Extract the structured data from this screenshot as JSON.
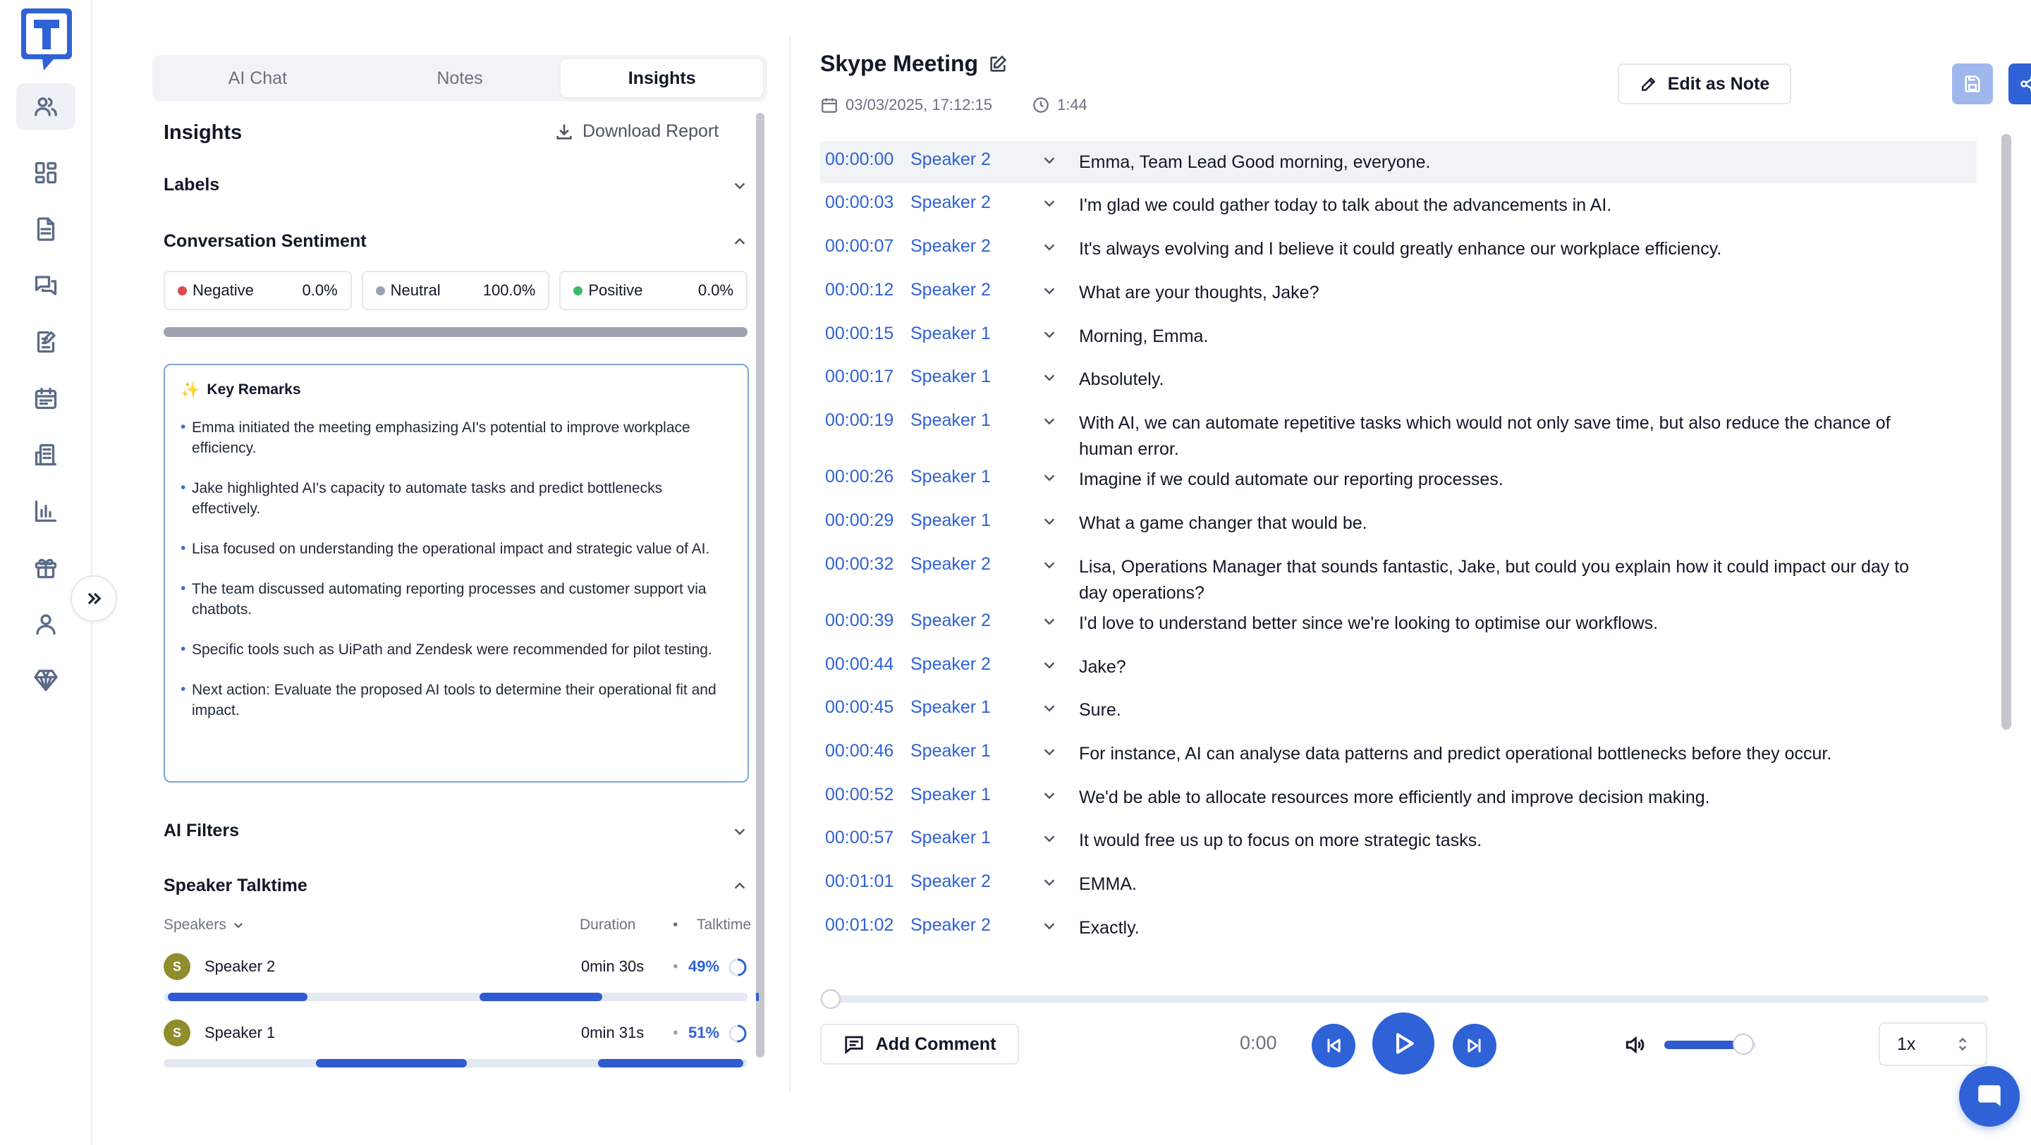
{
  "colors": {
    "accent": "#2f62d6",
    "negative": "#e0484e",
    "neutral": "#9ca3af",
    "positive": "#3fb86b",
    "avatar": "#8f8d2c"
  },
  "logo": {
    "letter": "T"
  },
  "nav": [
    {
      "icon": "users-icon",
      "active": true
    },
    {
      "icon": "dashboard-icon"
    },
    {
      "icon": "document-icon"
    },
    {
      "icon": "chat-icon"
    },
    {
      "icon": "edit-note-icon"
    },
    {
      "icon": "calendar-icon"
    },
    {
      "icon": "building-icon"
    },
    {
      "icon": "bar-chart-icon"
    },
    {
      "icon": "gift-icon"
    },
    {
      "icon": "user-icon"
    },
    {
      "icon": "diamond-icon"
    }
  ],
  "panel": {
    "tabs": [
      "AI Chat",
      "Notes",
      "Insights"
    ],
    "active_tab": "Insights",
    "title": "Insights",
    "download_label": "Download Report",
    "labels_heading": "Labels",
    "sentiment_heading": "Conversation Sentiment",
    "sentiment": [
      {
        "label": "Negative",
        "value": "0.0%"
      },
      {
        "label": "Neutral",
        "value": "100.0%"
      },
      {
        "label": "Positive",
        "value": "0.0%"
      }
    ],
    "key_remarks_title": "Key Remarks",
    "key_remarks": [
      "Emma initiated the meeting emphasizing AI's potential to improve workplace efficiency.",
      "Jake highlighted AI's capacity to automate tasks and predict bottlenecks effectively.",
      "Lisa focused on understanding the operational impact and strategic value of AI.",
      "The team discussed automating reporting processes and customer support via chatbots.",
      "Specific tools such as UiPath and Zendesk were recommended for pilot testing.",
      "Next action: Evaluate the proposed AI tools to determine their operational fit and impact."
    ],
    "ai_filters_heading": "AI Filters",
    "talktime_heading": "Speaker Talktime",
    "talktime_cols": {
      "speakers": "Speakers",
      "duration": "Duration",
      "sep": "•",
      "talktime": "Talktime"
    },
    "speakers": [
      {
        "initial": "S",
        "name": "Speaker 2",
        "duration": "0min 30s",
        "sep": "•",
        "pct": "49%",
        "fraction": 0.49
      },
      {
        "initial": "S",
        "name": "Speaker 1",
        "duration": "0min 31s",
        "sep": "•",
        "pct": "51%",
        "fraction": 0.51
      }
    ]
  },
  "meeting": {
    "title": "Skype Meeting",
    "datetime": "03/03/2025, 17:12:15",
    "duration": "1:44",
    "edit_note_label": "Edit as Note"
  },
  "transcript": [
    {
      "time": "00:00:00",
      "speaker": "Speaker 2",
      "text": "Emma, Team Lead Good morning, everyone."
    },
    {
      "time": "00:00:03",
      "speaker": "Speaker 2",
      "text": "I'm glad we could gather today to talk about the advancements in AI."
    },
    {
      "time": "00:00:07",
      "speaker": "Speaker 2",
      "text": "It's always evolving and I believe it could greatly enhance our workplace efficiency."
    },
    {
      "time": "00:00:12",
      "speaker": "Speaker 2",
      "text": "What are your thoughts, Jake?"
    },
    {
      "time": "00:00:15",
      "speaker": "Speaker 1",
      "text": "Morning, Emma."
    },
    {
      "time": "00:00:17",
      "speaker": "Speaker 1",
      "text": "Absolutely."
    },
    {
      "time": "00:00:19",
      "speaker": "Speaker 1",
      "text": "With AI, we can automate repetitive tasks which would not only save time, but also reduce the chance of human error."
    },
    {
      "time": "00:00:26",
      "speaker": "Speaker 1",
      "text": "Imagine if we could automate our reporting processes."
    },
    {
      "time": "00:00:29",
      "speaker": "Speaker 1",
      "text": "What a game changer that would be."
    },
    {
      "time": "00:00:32",
      "speaker": "Speaker 2",
      "text": "Lisa, Operations Manager that sounds fantastic, Jake, but could you explain how it could impact our day to day operations?"
    },
    {
      "time": "00:00:39",
      "speaker": "Speaker 2",
      "text": "I'd love to understand better since we're looking to optimise our workflows."
    },
    {
      "time": "00:00:44",
      "speaker": "Speaker 2",
      "text": "Jake?"
    },
    {
      "time": "00:00:45",
      "speaker": "Speaker 1",
      "text": "Sure."
    },
    {
      "time": "00:00:46",
      "speaker": "Speaker 1",
      "text": "For instance, AI can analyse data patterns and predict operational bottlenecks before they occur."
    },
    {
      "time": "00:00:52",
      "speaker": "Speaker 1",
      "text": "We'd be able to allocate resources more efficiently and improve decision making."
    },
    {
      "time": "00:00:57",
      "speaker": "Speaker 1",
      "text": "It would free us up to focus on more strategic tasks."
    },
    {
      "time": "00:01:01",
      "speaker": "Speaker 2",
      "text": "EMMA."
    },
    {
      "time": "00:01:02",
      "speaker": "Speaker 2",
      "text": "Exactly."
    }
  ],
  "player": {
    "add_comment_label": "Add Comment",
    "current_time": "0:00",
    "progress": 0,
    "volume": 0.85,
    "speed": "1x"
  }
}
